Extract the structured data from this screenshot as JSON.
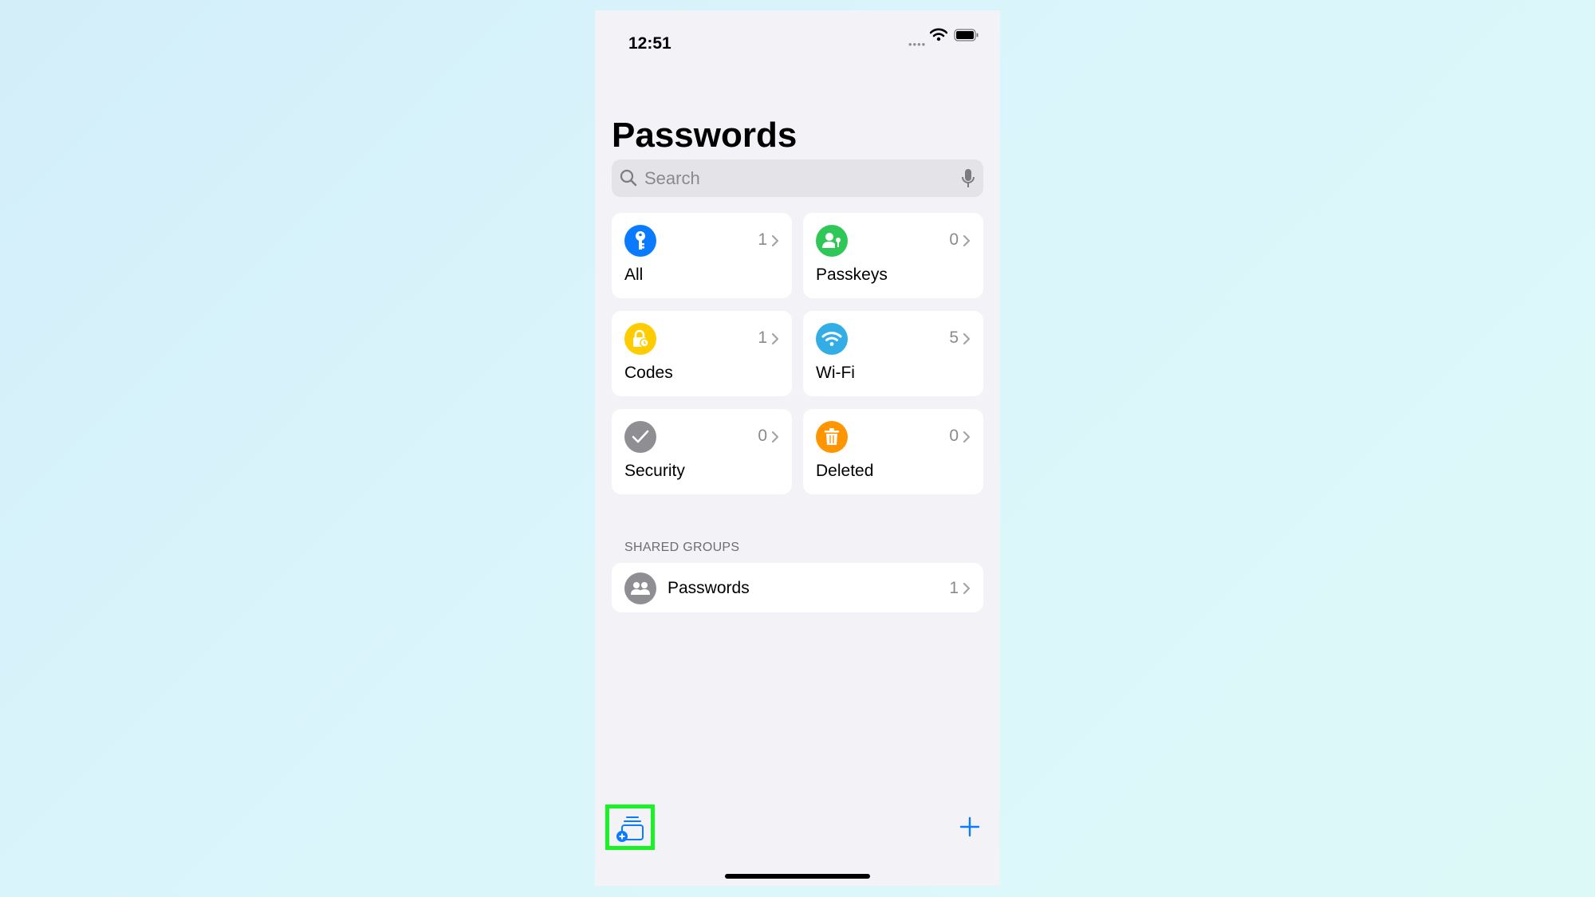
{
  "status_bar": {
    "time": "12:51"
  },
  "header": {
    "title": "Passwords"
  },
  "search": {
    "placeholder": "Search"
  },
  "categories": [
    {
      "label": "All",
      "count": "1",
      "icon": "key-icon",
      "color": "#0a7aff"
    },
    {
      "label": "Passkeys",
      "count": "0",
      "icon": "person-key-icon",
      "color": "#30c759"
    },
    {
      "label": "Codes",
      "count": "1",
      "icon": "lock-clock-icon",
      "color": "#ffcc00"
    },
    {
      "label": "Wi-Fi",
      "count": "5",
      "icon": "wifi-icon",
      "color": "#32ade6"
    },
    {
      "label": "Security",
      "count": "0",
      "icon": "checkmark-icon",
      "color": "#8e8e93"
    },
    {
      "label": "Deleted",
      "count": "0",
      "icon": "trash-icon",
      "color": "#ff9500"
    }
  ],
  "shared_groups": {
    "header": "SHARED GROUPS",
    "items": [
      {
        "label": "Passwords",
        "count": "1",
        "icon": "people-icon"
      }
    ]
  },
  "toolbar": {
    "new_group_icon": "new-shared-group-icon",
    "add_icon": "plus-icon",
    "accent_color": "#0a7aff",
    "highlight_color": "#19f224"
  }
}
